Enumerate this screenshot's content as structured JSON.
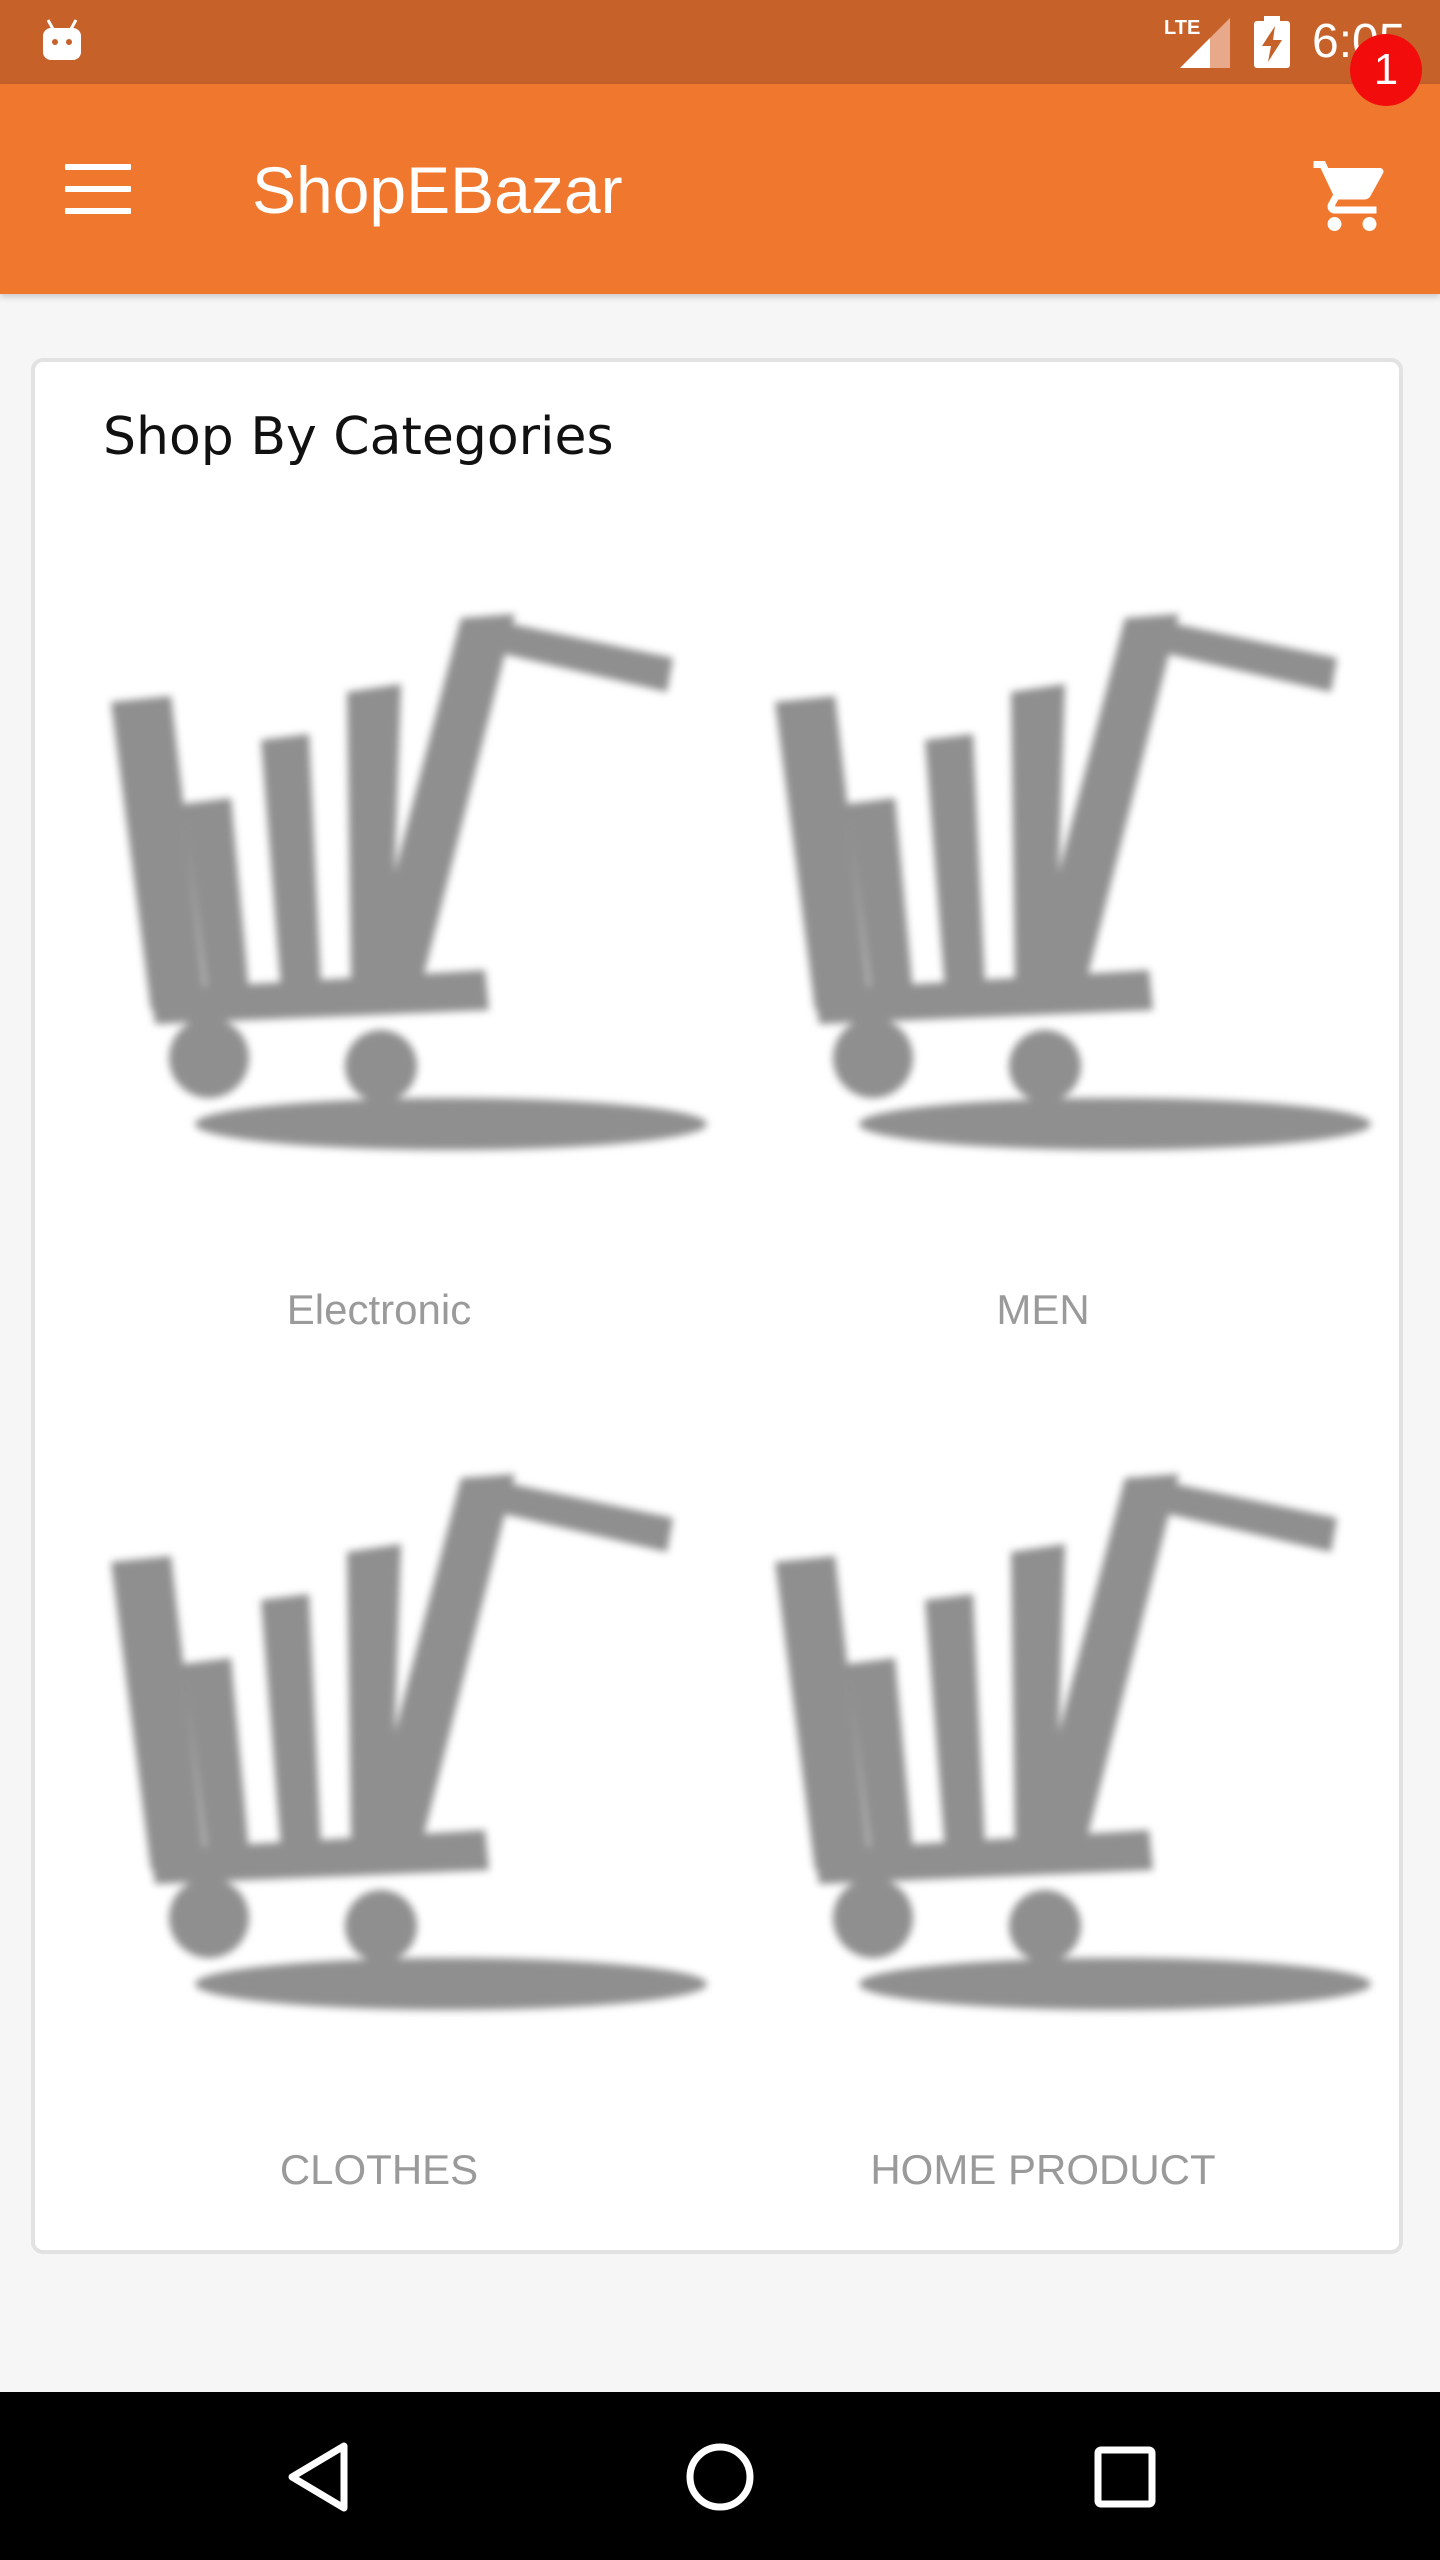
{
  "status_bar": {
    "time": "6:05",
    "network_label": "LTE",
    "icons": [
      "android-icon",
      "lte-signal-icon",
      "battery-charging-icon"
    ]
  },
  "app_bar": {
    "title": "ShopEBazar",
    "menu_icon": "menu-icon",
    "cart_icon": "cart-icon",
    "cart_count": "1",
    "color": "#f0772e"
  },
  "categories_section": {
    "title": "Shop By Categories",
    "items": [
      {
        "label": "Electronic",
        "icon": "shopping-cart-image"
      },
      {
        "label": "MEN",
        "icon": "shopping-cart-image"
      },
      {
        "label": "CLOTHES",
        "icon": "shopping-cart-image"
      },
      {
        "label": "HOME PRODUCT",
        "icon": "shopping-cart-image"
      }
    ]
  },
  "nav_bar": {
    "buttons": [
      "back-icon",
      "home-icon",
      "recents-icon"
    ]
  },
  "colors": {
    "status_bar": "#c6612a",
    "accent": "#f0772e",
    "badge": "#f20c0c",
    "category_text": "#9a9a9a"
  }
}
